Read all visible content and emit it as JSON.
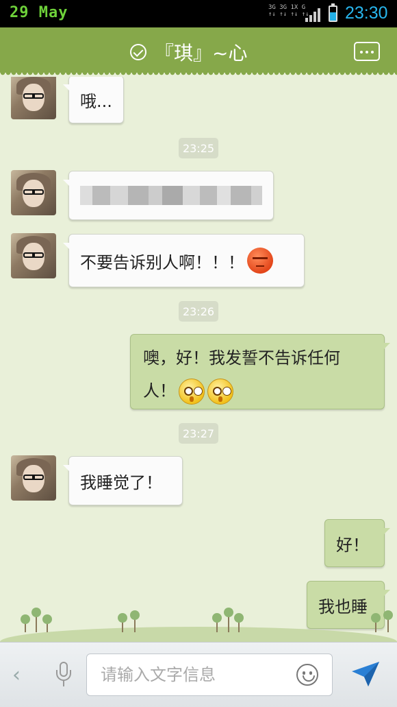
{
  "status_bar": {
    "date": "29 May",
    "network": "3G 3G 1X G",
    "battery_level": 0.6,
    "time": "23:30"
  },
  "header": {
    "title": "『琪』~心"
  },
  "messages": [
    {
      "type": "incoming",
      "text": "哦..."
    },
    {
      "type": "timestamp",
      "text": "23:25"
    },
    {
      "type": "incoming",
      "text": "",
      "note": "blurred"
    },
    {
      "type": "incoming",
      "text": "不要告诉别人啊！！！",
      "emoji": "angry-face-icon"
    },
    {
      "type": "timestamp",
      "text": "23:26"
    },
    {
      "type": "outgoing",
      "text": "噢，好！我发誓不告诉任何人！",
      "emoji": "stare-face-icon"
    },
    {
      "type": "timestamp",
      "text": "23:27"
    },
    {
      "type": "incoming",
      "text": "我睡觉了！"
    },
    {
      "type": "outgoing",
      "text": "好！"
    },
    {
      "type": "outgoing",
      "text": "我也睡"
    }
  ],
  "input_bar": {
    "placeholder": "请输入文字信息"
  },
  "colors": {
    "header_bg": "#86a84a",
    "chat_bg": "#e9f0d9",
    "outgoing_bubble": "#c9dca6",
    "incoming_bubble": "#fbfbfb",
    "clock": "#28b6ee",
    "send_icon": "#2a7fd4"
  }
}
